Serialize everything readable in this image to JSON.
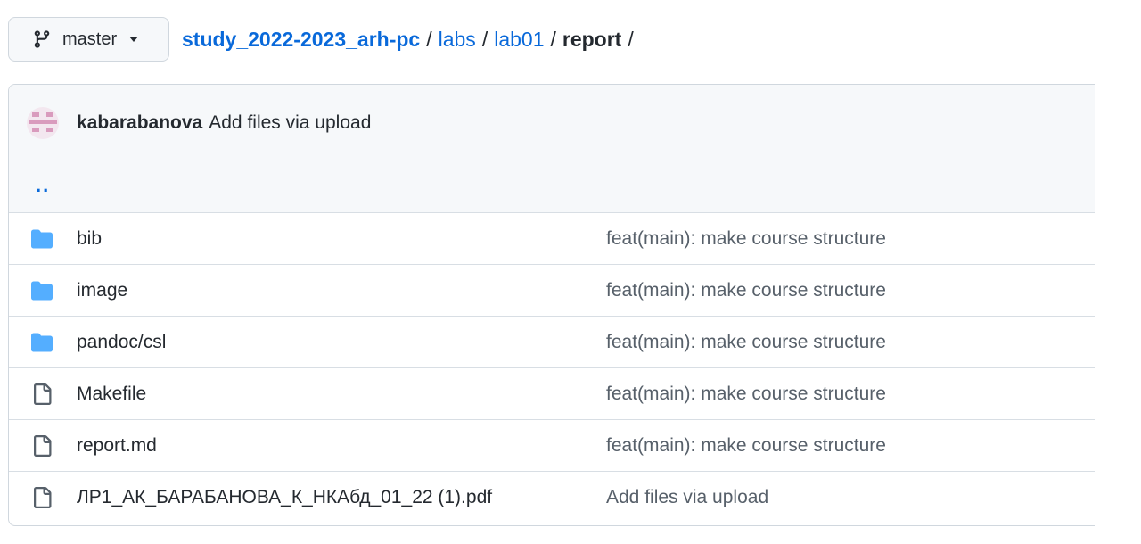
{
  "branch": {
    "label": "master",
    "icon": "git-branch-icon"
  },
  "breadcrumb": {
    "repo": "study_2022-2023_arh-pc",
    "parts": [
      "labs",
      "lab01"
    ],
    "current": "report",
    "separator": "/"
  },
  "commit": {
    "author": "kabarabanova",
    "message": "Add files via upload"
  },
  "up_link": "..",
  "files": [
    {
      "type": "folder",
      "icon": "folder-icon",
      "name": "bib",
      "message": "feat(main): make course structure"
    },
    {
      "type": "folder",
      "icon": "folder-icon",
      "name": "image",
      "message": "feat(main): make course structure"
    },
    {
      "type": "folder",
      "icon": "folder-icon",
      "name": "pandoc/csl",
      "message": "feat(main): make course structure"
    },
    {
      "type": "file",
      "icon": "file-icon",
      "name": "Makefile",
      "message": "feat(main): make course structure"
    },
    {
      "type": "file",
      "icon": "file-icon",
      "name": "report.md",
      "message": "feat(main): make course structure"
    },
    {
      "type": "file",
      "icon": "file-icon",
      "name": "ЛР1_АК_БАРАБАНОВА_К_НКАбд_01_22 (1).pdf",
      "message": "Add files via upload"
    }
  ],
  "colors": {
    "link": "#0969da",
    "folder": "#54aeff",
    "muted": "#57606a",
    "header_bg": "#f6f8fa"
  }
}
